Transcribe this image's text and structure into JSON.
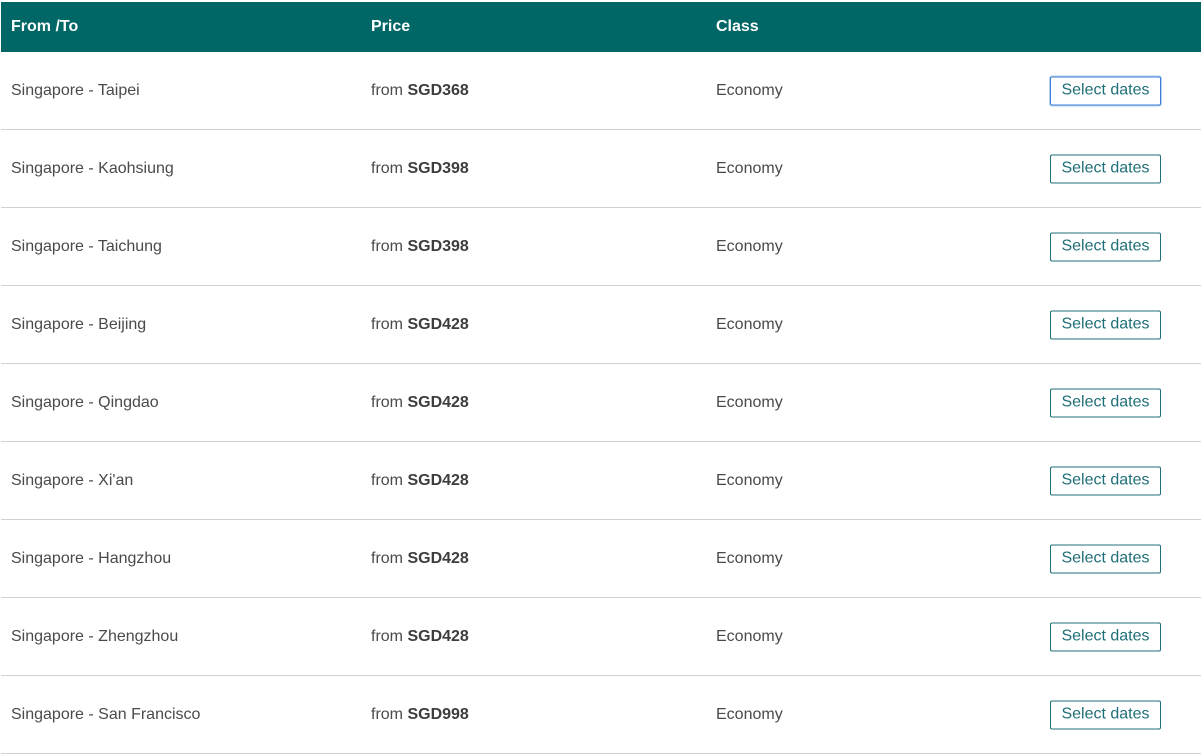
{
  "table": {
    "headers": {
      "route": "From /To",
      "price": "Price",
      "class": "Class"
    },
    "price_prefix": "from",
    "rows": [
      {
        "route": "Singapore - Taipei",
        "price": "SGD368",
        "class": "Economy",
        "action": "Select dates",
        "focused": true
      },
      {
        "route": "Singapore - Kaohsiung",
        "price": "SGD398",
        "class": "Economy",
        "action": "Select dates"
      },
      {
        "route": "Singapore - Taichung",
        "price": "SGD398",
        "class": "Economy",
        "action": "Select dates"
      },
      {
        "route": "Singapore - Beijing",
        "price": "SGD428",
        "class": "Economy",
        "action": "Select dates"
      },
      {
        "route": "Singapore - Qingdao",
        "price": "SGD428",
        "class": "Economy",
        "action": "Select dates"
      },
      {
        "route": "Singapore - Xi'an",
        "price": "SGD428",
        "class": "Economy",
        "action": "Select dates"
      },
      {
        "route": "Singapore - Hangzhou",
        "price": "SGD428",
        "class": "Economy",
        "action": "Select dates"
      },
      {
        "route": "Singapore - Zhengzhou",
        "price": "SGD428",
        "class": "Economy",
        "action": "Select dates"
      },
      {
        "route": "Singapore - San Francisco",
        "price": "SGD998",
        "class": "Economy",
        "action": "Select dates"
      }
    ]
  },
  "colors": {
    "header_bg": "#006666",
    "button_border": "#1f6f78",
    "row_divider": "#d2d2d2"
  }
}
